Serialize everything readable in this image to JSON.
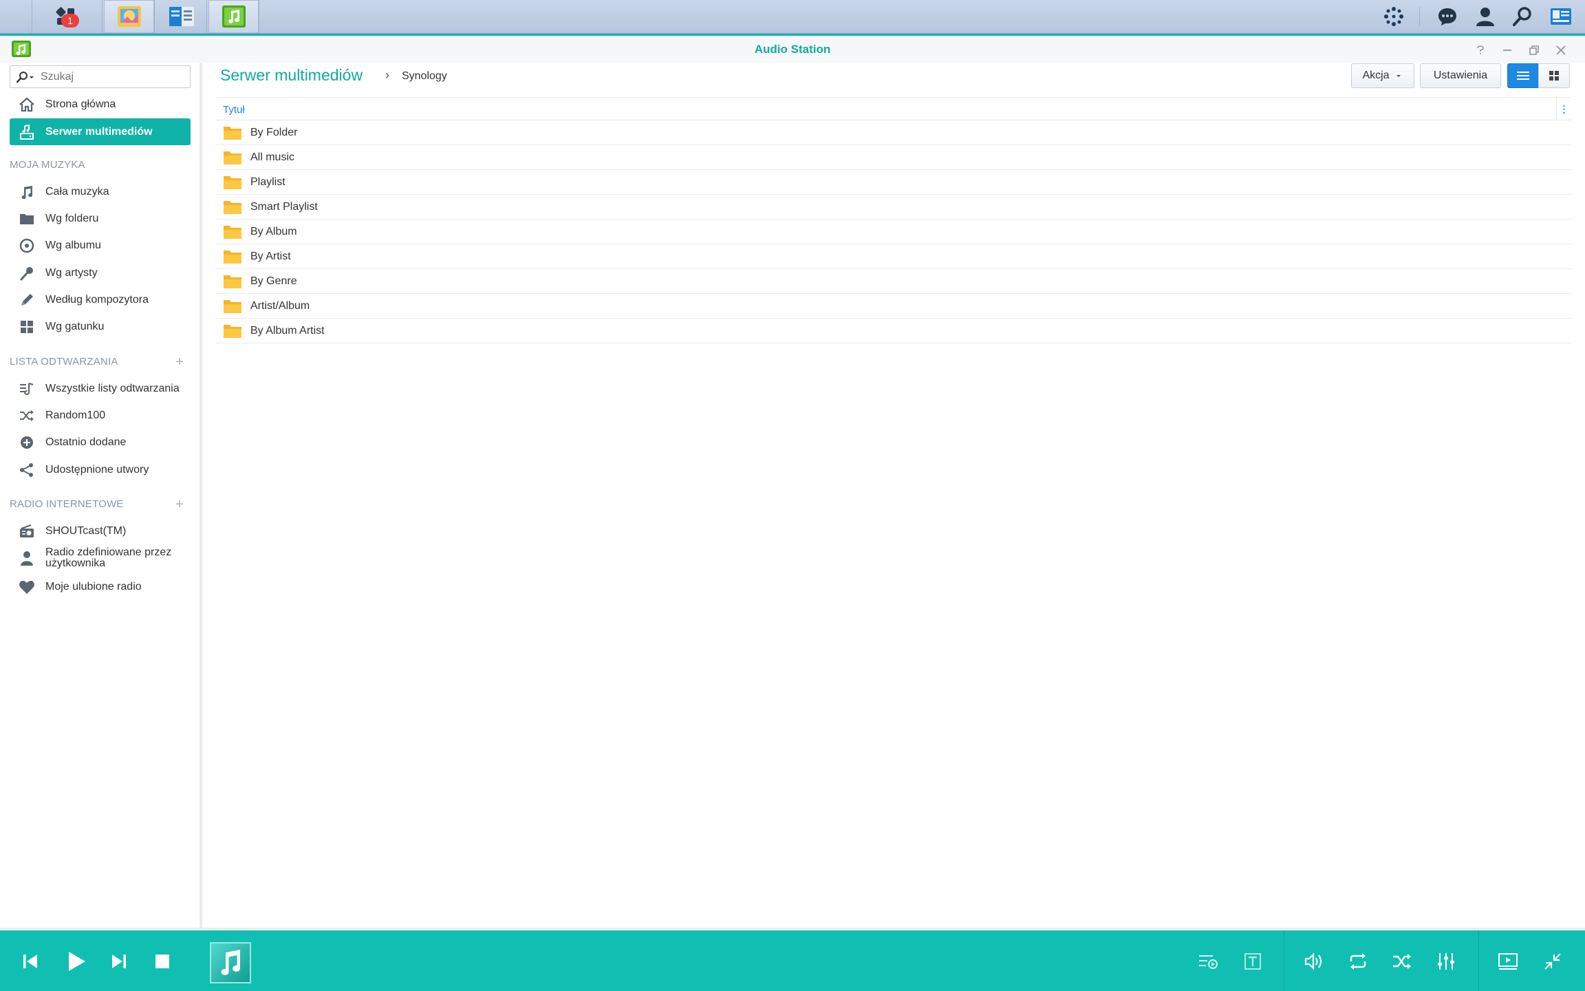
{
  "taskbar": {
    "main_menu_badge": "1",
    "buttons": [
      "main-menu",
      "photo-station",
      "file-station",
      "audio-station"
    ],
    "right_icons": [
      "synology-icon",
      "chat-icon",
      "user-icon",
      "search-icon",
      "widgets-icon"
    ]
  },
  "window": {
    "title": "Audio Station",
    "controls": [
      "help",
      "minimize",
      "restore",
      "close"
    ]
  },
  "sidebar": {
    "search_placeholder": "Szukaj",
    "top_items": [
      {
        "label": "Strona główna",
        "icon": "home-icon"
      },
      {
        "label": "Serwer multimediów",
        "icon": "media-server-icon",
        "selected": true
      }
    ],
    "sections": [
      {
        "title": "MOJA MUZYKA",
        "items": [
          {
            "label": "Cała muzyka",
            "icon": "music-note-icon"
          },
          {
            "label": "Wg folderu",
            "icon": "folder-icon"
          },
          {
            "label": "Wg albumu",
            "icon": "disc-icon"
          },
          {
            "label": "Wg artysty",
            "icon": "microphone-icon"
          },
          {
            "label": "Według kompozytora",
            "icon": "pen-icon"
          },
          {
            "label": "Wg gatunku",
            "icon": "grid-icon"
          }
        ]
      },
      {
        "title": "LISTA ODTWARZANIA",
        "add": "+",
        "items": [
          {
            "label": "Wszystkie listy odtwarzania",
            "icon": "playlist-icon"
          },
          {
            "label": "Random100",
            "icon": "shuffle-icon"
          },
          {
            "label": "Ostatnio dodane",
            "icon": "plus-circle-icon"
          },
          {
            "label": "Udostępnione utwory",
            "icon": "share-icon"
          }
        ]
      },
      {
        "title": "RADIO INTERNETOWE",
        "add": "+",
        "items": [
          {
            "label": "SHOUTcast(TM)",
            "icon": "radio-icon"
          },
          {
            "label_line1": "Radio zdefiniowane przez",
            "label_line2": "użytkownika",
            "icon": "user-radio-icon"
          },
          {
            "label": "Moje ulubione radio",
            "icon": "heart-icon"
          }
        ]
      }
    ]
  },
  "main": {
    "breadcrumb_root": "Serwer multimediów",
    "breadcrumb_sep": "›",
    "breadcrumb_leaf": "Synology",
    "action_button": "Akcja",
    "settings_button": "Ustawienia",
    "column_title": "Tytuł",
    "column_menu": "⋮",
    "rows": [
      "By Folder",
      "All music",
      "Playlist",
      "Smart Playlist",
      "By Album",
      "By Artist",
      "By Genre",
      "Artist/Album",
      "By Album Artist"
    ]
  },
  "player": {
    "controls_left": [
      "previous-icon",
      "play-icon",
      "next-icon",
      "stop-icon"
    ],
    "controls_right": [
      "queue-icon",
      "lyrics-icon",
      "volume-icon",
      "repeat-icon",
      "shuffle-icon",
      "equalizer-icon",
      "mini-player-icon",
      "collapse-icon"
    ]
  },
  "colors": {
    "accent": "#10b3a7",
    "player_bg": "#10bfb2",
    "title_text": "#10aaa3",
    "column_header": "#1e88e5",
    "folder": "#f6b42a",
    "taskbar": "#c0cde4"
  }
}
